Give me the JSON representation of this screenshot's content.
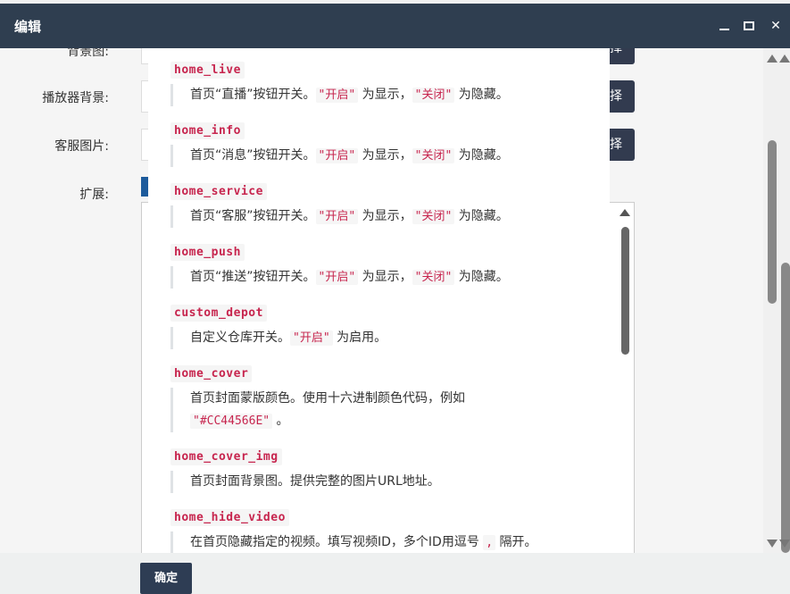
{
  "window": {
    "title": "编辑",
    "close_symbol": "✕"
  },
  "form": {
    "labels": [
      "背景图:",
      "播放器背景:",
      "客服图片:",
      "扩展:"
    ],
    "select_button_label": "择"
  },
  "docs": [
    {
      "key": "home_live",
      "parts": [
        "首页“直播”按钮开关。",
        "\"开启\"",
        " 为显示，",
        "\"关闭\"",
        " 为隐藏。"
      ]
    },
    {
      "key": "home_info",
      "parts": [
        "首页“消息”按钮开关。",
        "\"开启\"",
        " 为显示，",
        "\"关闭\"",
        " 为隐藏。"
      ]
    },
    {
      "key": "home_service",
      "parts": [
        "首页“客服”按钮开关。",
        "\"开启\"",
        " 为显示，",
        "\"关闭\"",
        " 为隐藏。"
      ]
    },
    {
      "key": "home_push",
      "parts": [
        "首页“推送”按钮开关。",
        "\"开启\"",
        " 为显示，",
        "\"关闭\"",
        " 为隐藏。"
      ]
    },
    {
      "key": "custom_depot",
      "parts": [
        "自定义仓库开关。",
        "\"开启\"",
        " 为启用。"
      ]
    },
    {
      "key": "home_cover",
      "parts": [
        "首页封面蒙版颜色。使用十六进制颜色代码，例如 ",
        "\"#CC44566E\"",
        " 。"
      ]
    },
    {
      "key": "home_cover_img",
      "parts": [
        "首页封面背景图。提供完整的图片URL地址。"
      ]
    },
    {
      "key": "home_hide_video",
      "parts": [
        "在首页隐藏指定的视频。填写视频ID，多个ID用逗号 ",
        ",",
        " 隔开。"
      ]
    }
  ],
  "footer": {
    "confirm_label": "确定"
  },
  "colors": {
    "titlebar": "#2f3e50",
    "code_text": "#c7254e",
    "confirm_button": "#2e3d54"
  }
}
